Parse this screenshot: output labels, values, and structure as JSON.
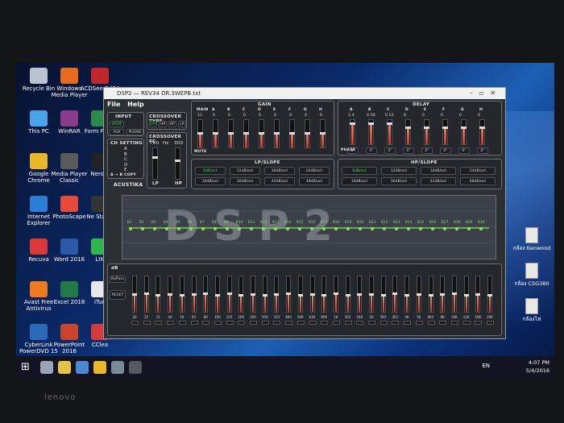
{
  "desktop_left_icons": [
    {
      "label": "Recycle Bin",
      "icon": "recycle-bin-icon",
      "color": "#b8c4d2"
    },
    {
      "label": "Windows Media Player",
      "icon": "media-player-icon",
      "color": "#e86a1c"
    },
    {
      "label": "ACDSee 9 (64",
      "icon": "acdsee-icon",
      "color": "#c0282d"
    },
    {
      "label": "This PC",
      "icon": "computer-icon",
      "color": "#4aa3e8"
    },
    {
      "label": "WinRAR",
      "icon": "winrar-icon",
      "color": "#8a3b8c"
    },
    {
      "label": "Form Facto",
      "icon": "app-icon",
      "color": "#2a8a4a"
    },
    {
      "label": "Google Chrome",
      "icon": "chrome-icon",
      "color": "#e8b82a"
    },
    {
      "label": "Media Player Classic",
      "icon": "mpc-icon",
      "color": "#5a5a5a"
    },
    {
      "label": "Nero h",
      "icon": "nero-icon",
      "color": "#222222"
    },
    {
      "label": "Internet Explorer",
      "icon": "ie-icon",
      "color": "#2a7fd4"
    },
    {
      "label": "PhotoScape",
      "icon": "photoscape-icon",
      "color": "#e84a3a"
    },
    {
      "label": "Ne StartS",
      "icon": "nero-start-icon",
      "color": "#333333"
    },
    {
      "label": "Recuva",
      "icon": "recuva-icon",
      "color": "#d83a3a"
    },
    {
      "label": "Word 2016",
      "icon": "word-icon",
      "color": "#2b5aa8"
    },
    {
      "label": "LIN",
      "icon": "line-icon",
      "color": "#2cb84a"
    },
    {
      "label": "Avast Free Antivirus",
      "icon": "avast-icon",
      "color": "#f07a1c"
    },
    {
      "label": "Excel 2016",
      "icon": "excel-icon",
      "color": "#1f7a44"
    },
    {
      "label": "iTun",
      "icon": "itunes-icon",
      "color": "#e8e8e8"
    },
    {
      "label": "CyberLink PowerDVD 15",
      "icon": "powerdvd-icon",
      "color": "#2a6ab8"
    },
    {
      "label": "PowerPoint 2016",
      "icon": "powerpoint-icon",
      "color": "#c8452a"
    },
    {
      "label": "CClea",
      "icon": "ccleaner-icon",
      "color": "#d83a3a"
    }
  ],
  "desktop_right_icons": [
    {
      "label": "กล้อง Kenwood"
    },
    {
      "label": "กล้อง CSG380"
    },
    {
      "label": "กล้องไฟ"
    }
  ],
  "taskbar": {
    "icons": [
      "task-view-icon",
      "file-explorer-icon",
      "store-icon",
      "chrome-icon",
      "media-icon",
      "acustika-icon"
    ],
    "lang": "EN",
    "time": "4:07 PM",
    "date": "5/4/2016"
  },
  "window": {
    "title": "DSP2 — REV34 DR.3WEPB.txt",
    "menu": [
      "File",
      "Help"
    ],
    "input": {
      "title": "INPUT",
      "options": [
        "SPDIF",
        "AUX",
        "PHONE"
      ]
    },
    "crossover_type": {
      "title": "CROSSOVER TYPE",
      "options": [
        "OFF",
        "HP",
        "BP",
        "LP"
      ]
    },
    "ch_setting": {
      "title": "CH SETTING",
      "rows": [
        "A",
        "B",
        "C",
        "D",
        "E"
      ],
      "copy": "A → B COPY"
    },
    "crossover_fc": {
      "title": "CROSSOVER FC",
      "lp_hz": "700",
      "unit": "Hz",
      "hp_hz": "300",
      "lp_label": "LP",
      "hp_label": "HP"
    },
    "logo": "ACUSTIKA",
    "gain": {
      "title": "GAIN",
      "channels": [
        "MAIN",
        "A",
        "B",
        "C",
        "D",
        "E",
        "F",
        "G",
        "H"
      ],
      "values": [
        "12",
        "0",
        "0",
        "0",
        "0",
        "0",
        "0",
        "0",
        "0"
      ],
      "mute": "MUTE"
    },
    "delay": {
      "title": "DELAY",
      "channels": [
        "A",
        "B",
        "C",
        "D",
        "E",
        "F",
        "G",
        "H"
      ],
      "values": [
        "2.4",
        "0.56",
        "0.52",
        "0",
        "0",
        "0",
        "0",
        "0"
      ],
      "phase_label": "PHASE",
      "phase": [
        "0°",
        "0°",
        "0°",
        "0°",
        "0°",
        "0°",
        "0°",
        "0°"
      ]
    },
    "lp_slope": {
      "title": "LP/SLOPE",
      "options": [
        "6dB/oct",
        "12dB/oct",
        "18dB/oct",
        "24dB/oct",
        "30dB/oct",
        "36dB/oct",
        "42dB/oct",
        "48dB/oct"
      ],
      "selected": "6dB/oct"
    },
    "hp_slope": {
      "title": "HP/SLOPE",
      "options": [
        "6dB/oct",
        "12dB/oct",
        "18dB/oct",
        "24dB/oct",
        "30dB/oct",
        "36dB/oct",
        "42dB/oct",
        "48dB/oct"
      ],
      "selected": "6dB/oct"
    },
    "eq_display": {
      "word": "DSP2",
      "bands": [
        "B1",
        "B2",
        "B3",
        "B4",
        "B5",
        "B6",
        "B7",
        "B8",
        "B9",
        "B10",
        "B11",
        "B12",
        "B13",
        "B14",
        "B15",
        "B16",
        "B17",
        "B18",
        "B19",
        "B20",
        "B21",
        "B22",
        "B23",
        "B24",
        "B25",
        "B26",
        "B27",
        "B28",
        "B29",
        "B30"
      ],
      "curve_color": "#6fcf4a"
    },
    "graphic_eq": {
      "db_label": "dB",
      "bypass": "ByPass",
      "reset": "RESET",
      "freqs": [
        "20",
        "25",
        "31",
        "40",
        "50",
        "63",
        "80",
        "100",
        "125",
        "160",
        "200",
        "250",
        "315",
        "400",
        "500",
        "630",
        "800",
        "1K",
        "1K2",
        "1K6",
        "2K",
        "2K5",
        "3K1",
        "4K",
        "5K",
        "6K3",
        "8K",
        "10K",
        "12K",
        "16K",
        "20K"
      ],
      "levels": [
        0.52,
        0.55,
        0.5,
        0.53,
        0.5,
        0.52,
        0.54,
        0.5,
        0.55,
        0.51,
        0.53,
        0.5,
        0.52,
        0.54,
        0.5,
        0.53,
        0.51,
        0.55,
        0.5,
        0.52,
        0.53,
        0.5,
        0.54,
        0.51,
        0.52,
        0.5,
        0.53,
        0.55,
        0.5,
        0.52,
        0.51
      ]
    }
  }
}
